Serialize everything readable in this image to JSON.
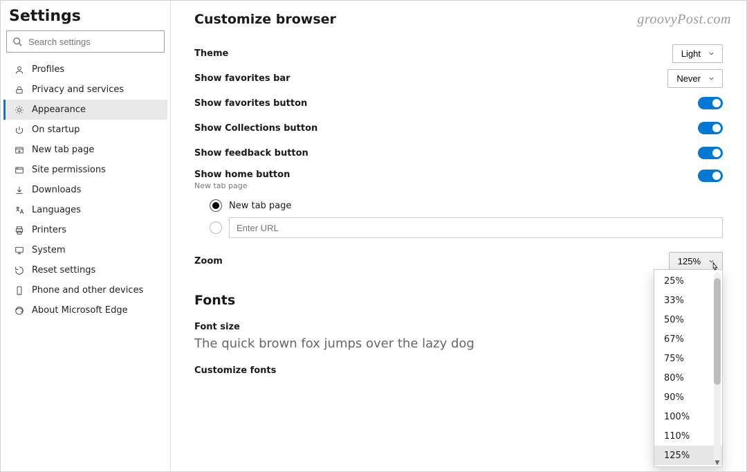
{
  "watermark": "groovyPost.com",
  "sidebar": {
    "title": "Settings",
    "search_placeholder": "Search settings",
    "items": [
      {
        "label": "Profiles",
        "icon": "person-icon"
      },
      {
        "label": "Privacy and services",
        "icon": "lock-icon"
      },
      {
        "label": "Appearance",
        "icon": "appearance-icon"
      },
      {
        "label": "On startup",
        "icon": "power-icon"
      },
      {
        "label": "New tab page",
        "icon": "newtab-icon"
      },
      {
        "label": "Site permissions",
        "icon": "site-icon"
      },
      {
        "label": "Downloads",
        "icon": "download-icon"
      },
      {
        "label": "Languages",
        "icon": "languages-icon"
      },
      {
        "label": "Printers",
        "icon": "printer-icon"
      },
      {
        "label": "System",
        "icon": "system-icon"
      },
      {
        "label": "Reset settings",
        "icon": "reset-icon"
      },
      {
        "label": "Phone and other devices",
        "icon": "phone-icon"
      },
      {
        "label": "About Microsoft Edge",
        "icon": "edge-icon"
      }
    ],
    "active_index": 2
  },
  "main": {
    "heading": "Customize browser",
    "theme": {
      "label": "Theme",
      "value": "Light"
    },
    "favorites_bar": {
      "label": "Show favorites bar",
      "value": "Never"
    },
    "favorites_button": {
      "label": "Show favorites button",
      "on": true
    },
    "collections_button": {
      "label": "Show Collections button",
      "on": true
    },
    "feedback_button": {
      "label": "Show feedback button",
      "on": true
    },
    "home_button": {
      "label": "Show home button",
      "sublabel": "New tab page",
      "on": true
    },
    "home_options": {
      "newtab_label": "New tab page",
      "url_placeholder": "Enter URL",
      "selected": "newtab"
    },
    "zoom": {
      "label": "Zoom",
      "value": "125%",
      "options": [
        "25%",
        "33%",
        "50%",
        "67%",
        "75%",
        "80%",
        "90%",
        "100%",
        "110%",
        "125%"
      ]
    },
    "fonts": {
      "heading": "Fonts",
      "size_label": "Font size",
      "sample": "The quick brown fox jumps over the lazy dog",
      "customize_label": "Customize fonts"
    }
  }
}
